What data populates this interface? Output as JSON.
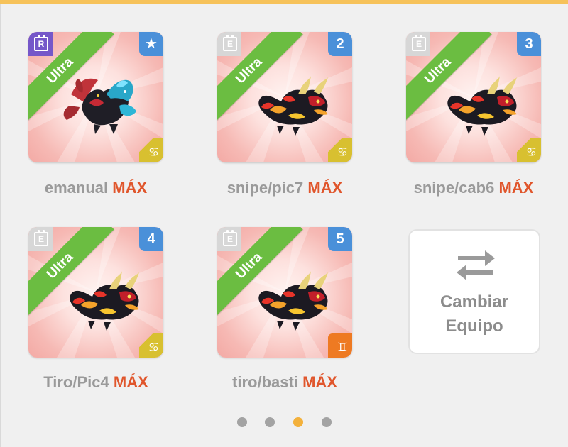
{
  "team_cards": [
    {
      "name": "emanual",
      "level_tag": "MÁX",
      "rarity": "Ultra",
      "corner_letter": "R",
      "corner_style": "purple",
      "badge": "★",
      "element_symbol": "♋",
      "element_color": "#d8c030"
    },
    {
      "name": "snipe/pic7",
      "level_tag": "MÁX",
      "rarity": "Ultra",
      "corner_letter": "E",
      "corner_style": "gray",
      "badge": "2",
      "element_symbol": "♋",
      "element_color": "#d8c030"
    },
    {
      "name": "snipe/cab6",
      "level_tag": "MÁX",
      "rarity": "Ultra",
      "corner_letter": "E",
      "corner_style": "gray",
      "badge": "3",
      "element_symbol": "♋",
      "element_color": "#d8c030"
    },
    {
      "name": "Tiro/Pic4",
      "level_tag": "MÁX",
      "rarity": "Ultra",
      "corner_letter": "E",
      "corner_style": "gray",
      "badge": "4",
      "element_symbol": "♋",
      "element_color": "#d8c030"
    },
    {
      "name": "tiro/basti",
      "level_tag": "MÁX",
      "rarity": "Ultra",
      "corner_letter": "E",
      "corner_style": "gray",
      "badge": "5",
      "element_symbol": "♊",
      "element_color": "#ee7a22"
    }
  ],
  "swap_button": {
    "line1": "Cambiar",
    "line2": "Equipo",
    "icon": "swap-arrows-icon"
  },
  "pagination": {
    "pages": 4,
    "current": 3
  },
  "colors": {
    "accent": "#f3b13c",
    "max_label": "#e0562c",
    "ribbon": "#6bbd41",
    "badge": "#4a90d9"
  }
}
